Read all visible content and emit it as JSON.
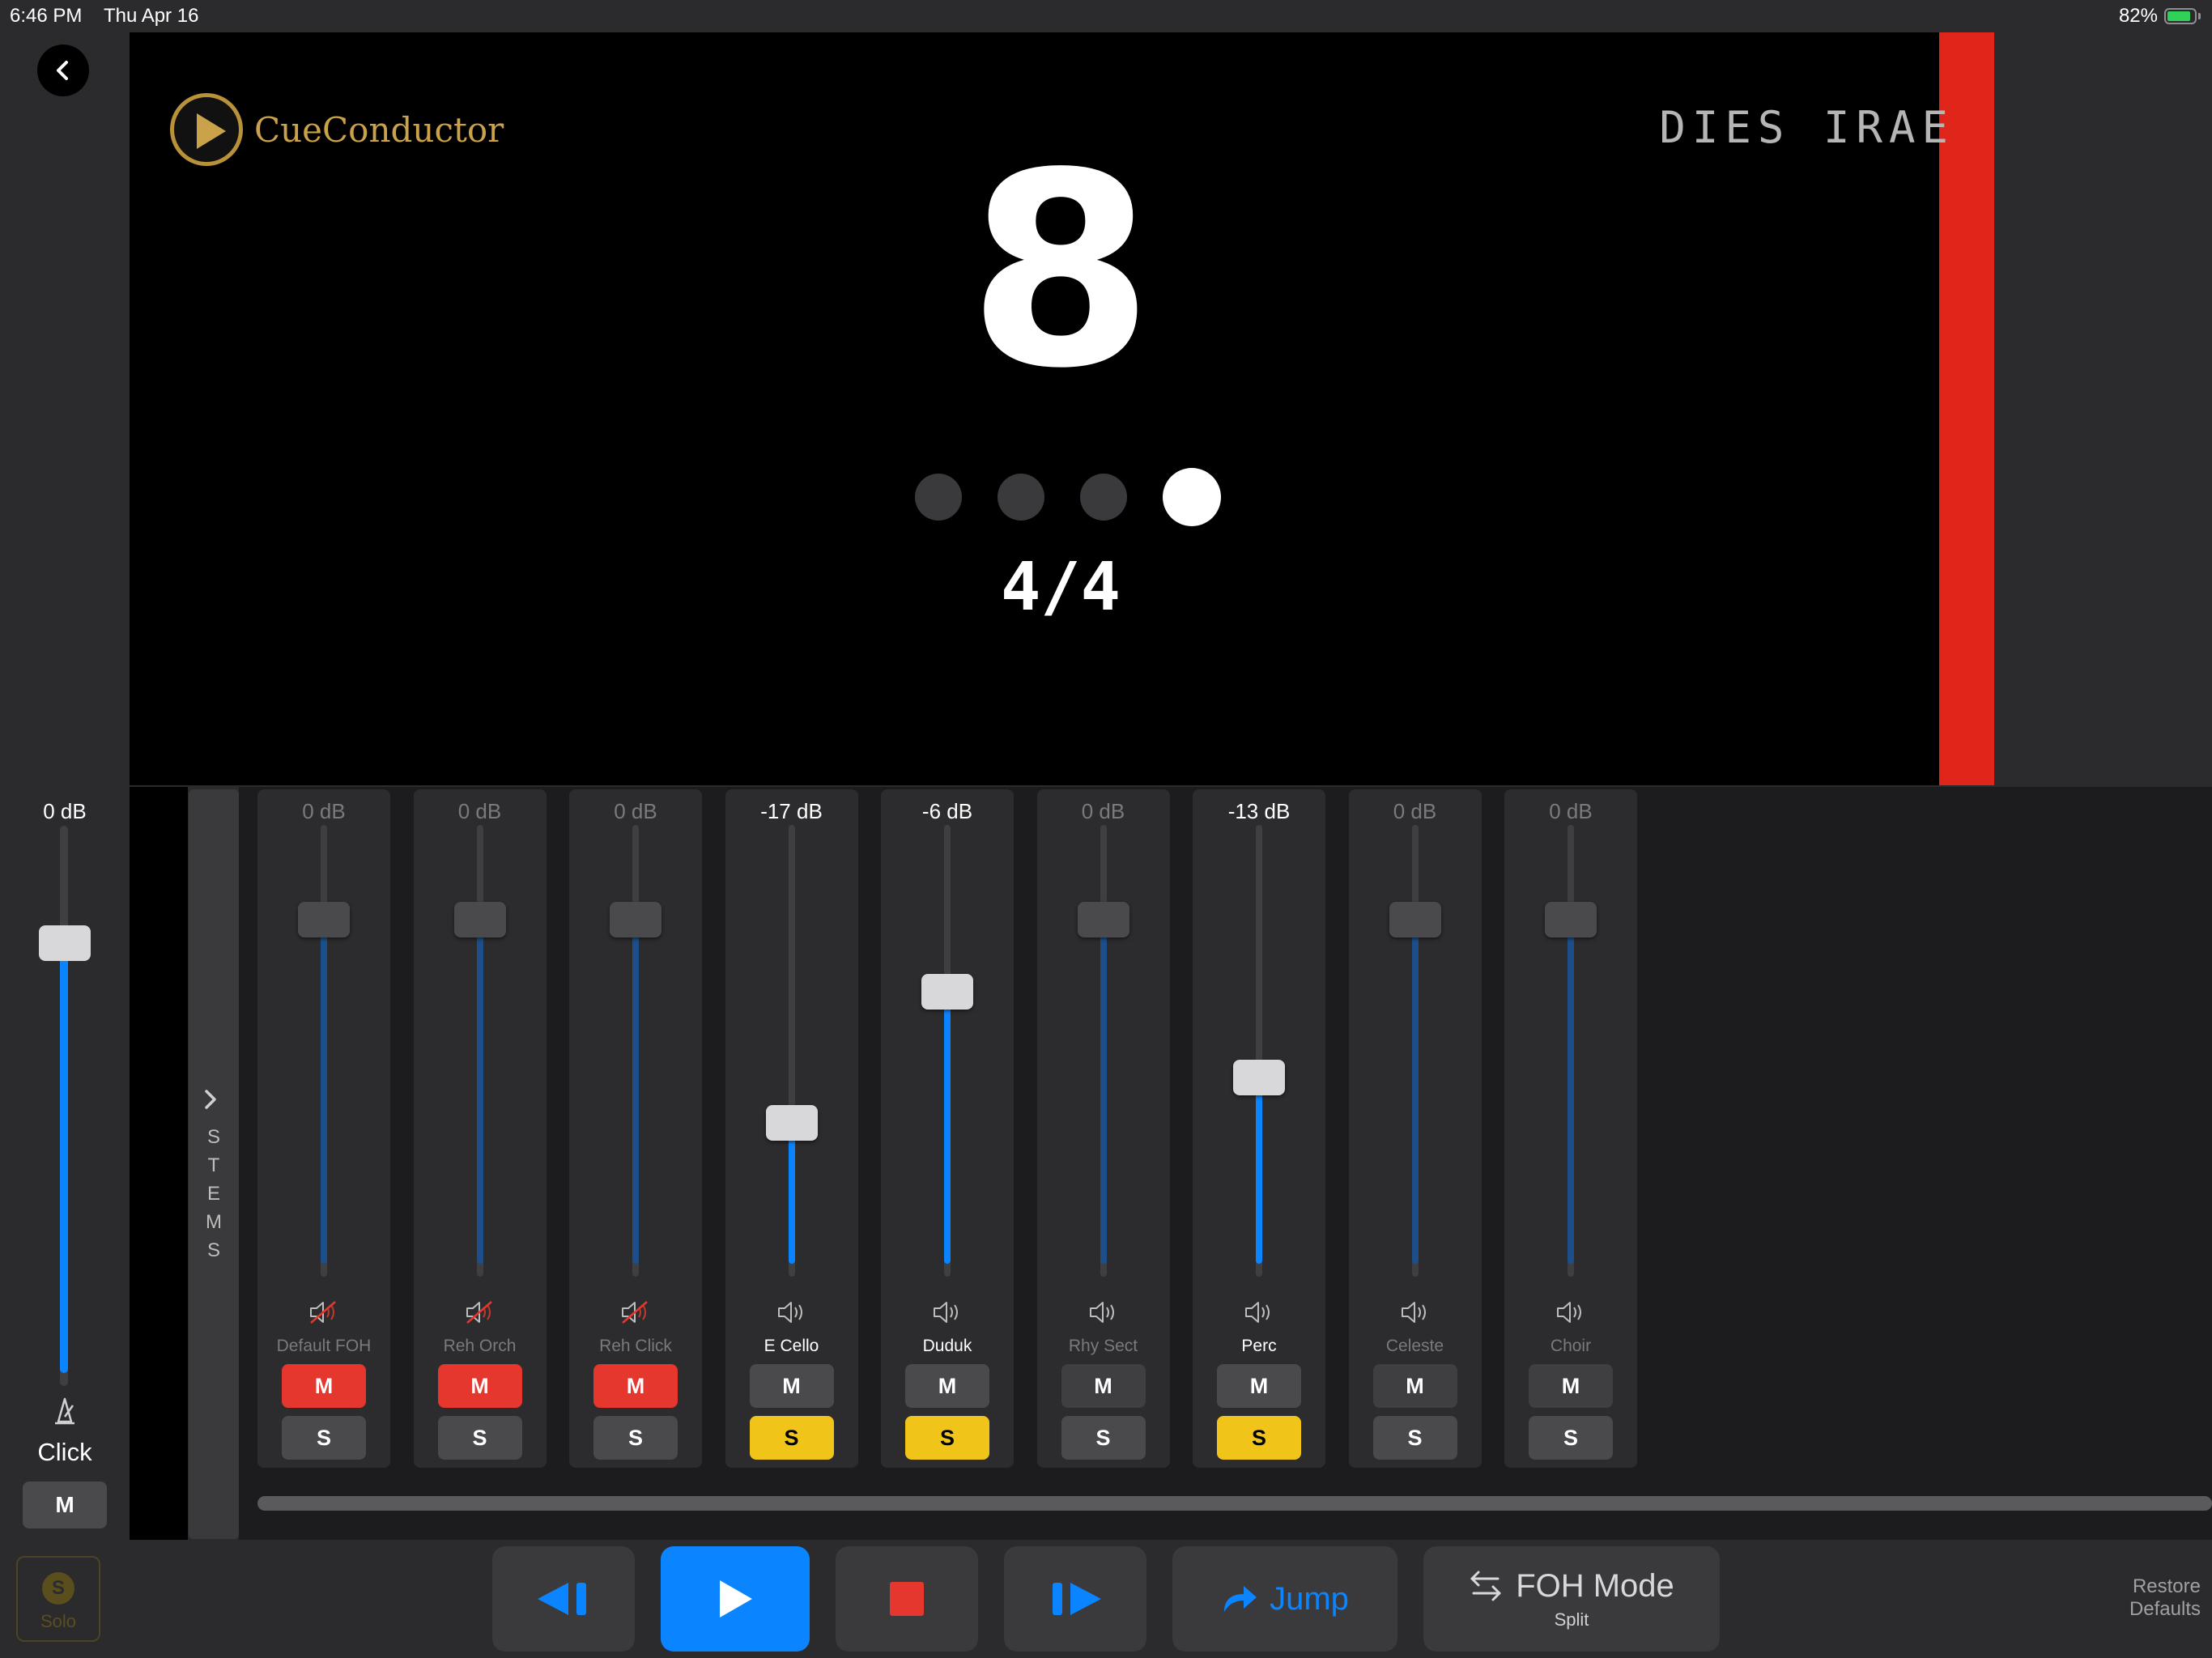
{
  "status_bar": {
    "time": "6:46 PM",
    "date": "Thu Apr 16",
    "battery": "82%"
  },
  "display": {
    "logo_text": "CueConductor",
    "song_title": "DIES IRAE",
    "beat_number": "8",
    "time_signature": "4/4",
    "beats_total": 4,
    "active_beat": 4,
    "accent_color": "#e0261a"
  },
  "click_channel": {
    "db": "0 dB",
    "label": "Click",
    "mute_label": "M",
    "level": 0.79
  },
  "stems_tab": {
    "letters": [
      "S",
      "T",
      "E",
      "M",
      "S"
    ]
  },
  "channels": [
    {
      "label": "Default FOH",
      "db": "0 dB",
      "muted": true,
      "soloed": false,
      "level": 0.79,
      "dim": true
    },
    {
      "label": "Reh Orch",
      "db": "0 dB",
      "muted": true,
      "soloed": false,
      "level": 0.79,
      "dim": true
    },
    {
      "label": "Reh Click",
      "db": "0 dB",
      "muted": true,
      "soloed": false,
      "level": 0.79,
      "dim": true
    },
    {
      "label": "E Cello",
      "db": "-17 dB",
      "muted": false,
      "soloed": true,
      "level": 0.34,
      "dim": false
    },
    {
      "label": "Duduk",
      "db": "-6 dB",
      "muted": false,
      "soloed": true,
      "level": 0.63,
      "dim": false
    },
    {
      "label": "Rhy Sect",
      "db": "0 dB",
      "muted": false,
      "soloed": false,
      "level": 0.79,
      "dim": true
    },
    {
      "label": "Perc",
      "db": "-13 dB",
      "muted": false,
      "soloed": true,
      "level": 0.44,
      "dim": false
    },
    {
      "label": "Celeste",
      "db": "0 dB",
      "muted": false,
      "soloed": false,
      "level": 0.79,
      "dim": true
    },
    {
      "label": "Choir",
      "db": "0 dB",
      "muted": false,
      "soloed": false,
      "level": 0.79,
      "dim": true
    }
  ],
  "button_labels": {
    "mute": "M",
    "solo": "S"
  },
  "transport": {
    "solo_badge": "S",
    "solo_label": "Solo",
    "jump_label": "Jump",
    "foh_label": "FOH Mode",
    "foh_sub": "Split",
    "restore_line1": "Restore",
    "restore_line2": "Defaults"
  }
}
